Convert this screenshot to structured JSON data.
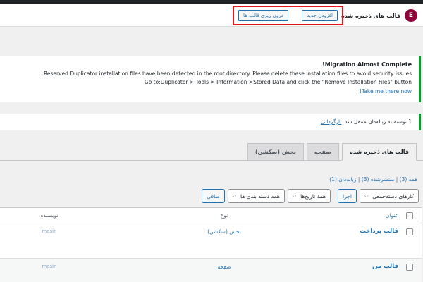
{
  "header": {
    "title": "قالب های ذخیره شده",
    "logo_letter": "E",
    "add_new_label": "افزودن جدید",
    "import_label": "درون ریزی قالب ها"
  },
  "notices": {
    "migration": {
      "title": "!Migration Almost Complete",
      "line1": ".Reserved Duplicator installation files have been detected in the root directory. Please delete these installation files to avoid security issues",
      "line2": "Go to:Duplicator > Tools > Information >Stored Data and click the \"Remove Installation Files\" button",
      "link": "!Take me there now"
    },
    "trash": {
      "text": "1 نوشته به زباله‌دان منتقل شد.",
      "undo_link": "بازگردانی"
    }
  },
  "tabs": [
    {
      "label": "قالب های ذخیره شده",
      "active": true
    },
    {
      "label": "صفحه",
      "active": false
    },
    {
      "label": "بخش (سکشن)",
      "active": false
    }
  ],
  "status_links": {
    "all": "همه (3)",
    "sep1": " | ",
    "published": "منتشرشده (3)",
    "sep2": " | ",
    "trash": "زباله‌دان (1)"
  },
  "filters": {
    "bulk_actions": "کارهای دسته‌جمعی",
    "apply": "اجرا",
    "all_dates": "همهٔ تاریخ‌ها",
    "all_categories": "همه دسته بندی ها",
    "filter_btn": "صافی"
  },
  "table": {
    "headers": {
      "title": "عنوان",
      "type": "نوع",
      "author": "نویسنده"
    },
    "rows": [
      {
        "title": "قالب پرداخت",
        "type": "بخش (سکشن)",
        "author": "masin"
      },
      {
        "title": "قالب من",
        "type": "صفحه",
        "author": "masin"
      }
    ]
  },
  "colors": {
    "accent": "#2271b1",
    "brand": "#92003b",
    "success_border": "#00a32a",
    "highlight_box": "#e3141c"
  }
}
